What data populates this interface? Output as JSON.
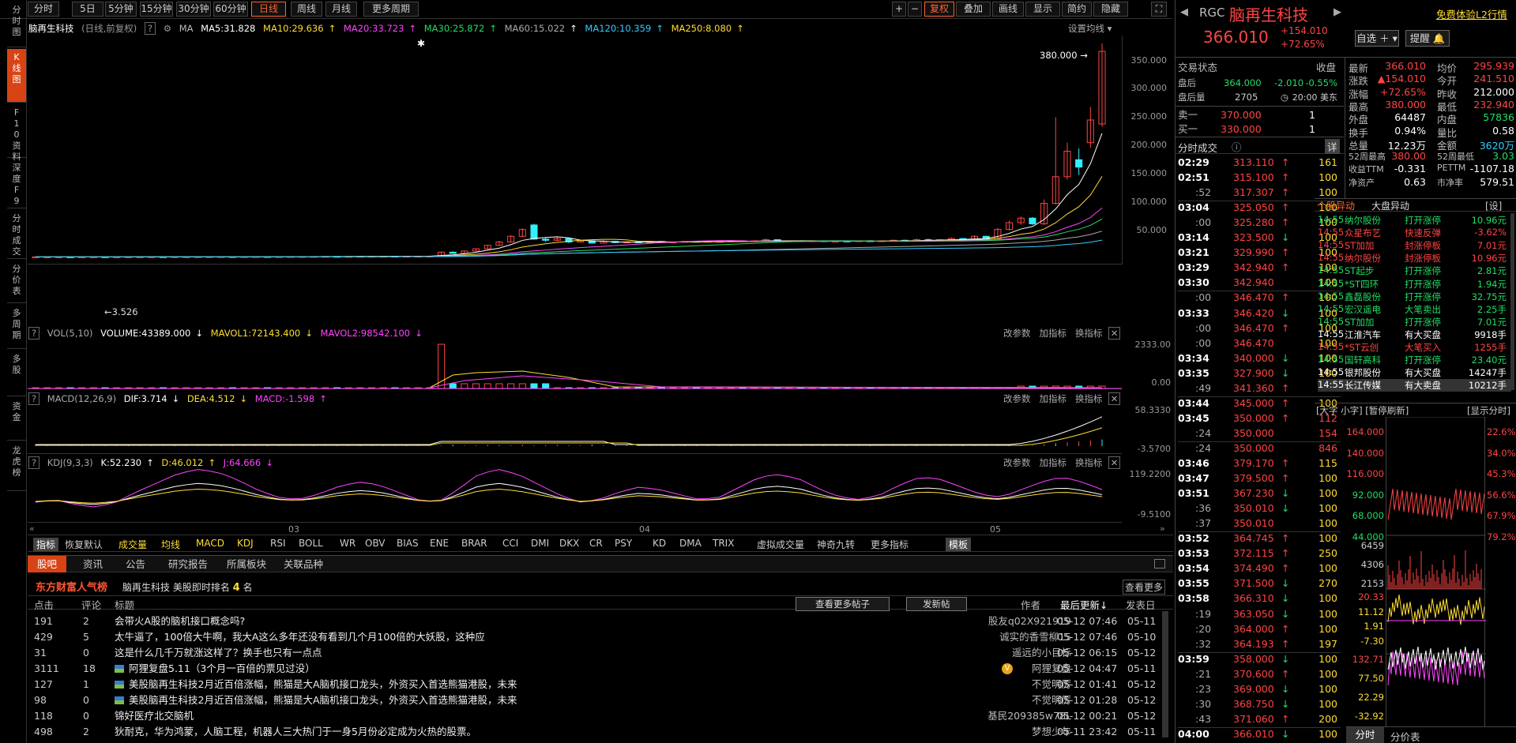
{
  "toolbar": {
    "periods": [
      "分时",
      "5日",
      "5分钟",
      "15分钟",
      "30分钟",
      "60分钟",
      "日线",
      "周线",
      "月线",
      "更多周期"
    ],
    "right": [
      "复权",
      "叠加",
      "画线",
      "显示",
      "简约",
      "隐藏"
    ]
  },
  "side_tabs": [
    "分时图",
    "K线图",
    "F10资料",
    "深度F9",
    "分时成交",
    "分价表",
    "多周期",
    "多股",
    "资金",
    "龙虎榜"
  ],
  "chart": {
    "stock_name": "脑再生科技",
    "mode": "(日线,前复权)",
    "ma_label": "MA",
    "ma": [
      "MA5:31.828",
      "MA10:29.636",
      "MA20:33.723",
      "MA30:25.872",
      "MA60:15.022",
      "MA120:10.359",
      "MA250:8.080"
    ],
    "settings": "设置均线",
    "high_label": "380.000",
    "low_label": "3.526",
    "y_ticks": [
      "350.000",
      "300.000",
      "250.000",
      "200.000",
      "150.000",
      "100.000",
      "50.000"
    ],
    "vol_head": [
      "VOL(5,10)",
      "VOLUME:43389.000",
      "MAVOL1:72143.400",
      "MAVOL2:98542.100"
    ],
    "vol_ticks": [
      "2333.00",
      "0.00"
    ],
    "macd_head": [
      "MACD(12,26,9)",
      "DIF:3.714",
      "DEA:4.512",
      "MACD:-1.598"
    ],
    "macd_ticks": [
      "58.3330",
      "-3.5700"
    ],
    "kdj_head": [
      "KDJ(9,3,3)",
      "K:52.230",
      "D:46.012",
      "J:64.666"
    ],
    "kdj_ticks": [
      "119.2200",
      "-9.5100"
    ],
    "pane_tools": [
      "改参数",
      "加指标",
      "换指标"
    ],
    "x_labels": [
      "03",
      "04",
      "05"
    ]
  },
  "chart_data": {
    "type": "candlestick",
    "title": "脑再生科技",
    "ylim": [
      0,
      380
    ],
    "x_labels": [
      "03",
      "04",
      "05"
    ],
    "candles": [
      {
        "o": 3.6,
        "c": 3.7,
        "h": 3.9,
        "l": 3.5
      },
      {
        "o": 3.6,
        "c": 3.6,
        "h": 3.8,
        "l": 3.5
      },
      {
        "o": 3.6,
        "c": 3.7,
        "h": 3.9,
        "l": 3.5
      },
      {
        "o": 3.7,
        "c": 3.6,
        "h": 3.8,
        "l": 3.5
      },
      {
        "o": 3.6,
        "c": 3.7,
        "h": 3.8,
        "l": 3.5
      },
      {
        "o": 3.7,
        "c": 3.8,
        "h": 3.9,
        "l": 3.6
      },
      {
        "o": 3.8,
        "c": 3.7,
        "h": 3.9,
        "l": 3.6
      },
      {
        "o": 3.7,
        "c": 3.7,
        "h": 3.8,
        "l": 3.6
      },
      {
        "o": 3.7,
        "c": 3.8,
        "h": 3.9,
        "l": 3.6
      },
      {
        "o": 3.8,
        "c": 3.8,
        "h": 4.0,
        "l": 3.7
      },
      {
        "o": 3.8,
        "c": 3.9,
        "h": 4.0,
        "l": 3.7
      },
      {
        "o": 3.9,
        "c": 3.8,
        "h": 4.0,
        "l": 3.7
      },
      {
        "o": 3.8,
        "c": 3.9,
        "h": 4.0,
        "l": 3.7
      },
      {
        "o": 3.9,
        "c": 3.9,
        "h": 4.0,
        "l": 3.8
      },
      {
        "o": 3.9,
        "c": 4.0,
        "h": 4.1,
        "l": 3.8
      },
      {
        "o": 4.0,
        "c": 4.0,
        "h": 4.1,
        "l": 3.9
      },
      {
        "o": 4.0,
        "c": 4.1,
        "h": 4.2,
        "l": 3.9
      },
      {
        "o": 4.1,
        "c": 4.0,
        "h": 4.2,
        "l": 3.9
      },
      {
        "o": 4.0,
        "c": 4.1,
        "h": 4.2,
        "l": 3.9
      },
      {
        "o": 4.1,
        "c": 4.2,
        "h": 4.3,
        "l": 4.0
      },
      {
        "o": 4.2,
        "c": 4.1,
        "h": 4.3,
        "l": 4.0
      },
      {
        "o": 4.1,
        "c": 4.2,
        "h": 4.3,
        "l": 4.0
      },
      {
        "o": 4.2,
        "c": 4.3,
        "h": 4.4,
        "l": 4.1
      },
      {
        "o": 4.3,
        "c": 4.3,
        "h": 4.4,
        "l": 4.2
      },
      {
        "o": 4.3,
        "c": 4.4,
        "h": 4.5,
        "l": 4.2
      },
      {
        "o": 4.4,
        "c": 4.5,
        "h": 4.6,
        "l": 4.3
      },
      {
        "o": 4.5,
        "c": 4.4,
        "h": 4.6,
        "l": 4.3
      },
      {
        "o": 4.4,
        "c": 4.5,
        "h": 4.6,
        "l": 4.3
      },
      {
        "o": 4.5,
        "c": 4.6,
        "h": 4.7,
        "l": 4.4
      },
      {
        "o": 4.6,
        "c": 4.7,
        "h": 4.8,
        "l": 4.5
      },
      {
        "o": 4.7,
        "c": 4.8,
        "h": 4.9,
        "l": 4.6
      },
      {
        "o": 4.8,
        "c": 4.7,
        "h": 4.9,
        "l": 4.6
      },
      {
        "o": 4.7,
        "c": 4.8,
        "h": 4.9,
        "l": 4.6
      },
      {
        "o": 4.8,
        "c": 4.9,
        "h": 5.0,
        "l": 4.7
      },
      {
        "o": 4.9,
        "c": 5.0,
        "h": 5.1,
        "l": 4.8
      },
      {
        "o": 5.0,
        "c": 12.0,
        "h": 13.0,
        "l": 5.0
      },
      {
        "o": 12.0,
        "c": 10.0,
        "h": 13.5,
        "l": 9.5
      },
      {
        "o": 10.0,
        "c": 14.0,
        "h": 15.0,
        "l": 9.8
      },
      {
        "o": 14.0,
        "c": 18.0,
        "h": 19.0,
        "l": 13.5
      },
      {
        "o": 18.0,
        "c": 24.0,
        "h": 25.0,
        "l": 17.0
      },
      {
        "o": 24.0,
        "c": 30.0,
        "h": 32.0,
        "l": 23.0
      },
      {
        "o": 30.0,
        "c": 40.0,
        "h": 42.0,
        "l": 29.0
      },
      {
        "o": 40.0,
        "c": 52.0,
        "h": 54.0,
        "l": 39.0
      },
      {
        "o": 60.0,
        "c": 35.0,
        "h": 62.0,
        "l": 34.0
      },
      {
        "o": 35.0,
        "c": 33.0,
        "h": 38.0,
        "l": 30.0
      },
      {
        "o": 33.0,
        "c": 36.0,
        "h": 39.0,
        "l": 31.0
      },
      {
        "o": 36.0,
        "c": 30.0,
        "h": 37.0,
        "l": 28.0
      },
      {
        "o": 30.0,
        "c": 32.0,
        "h": 34.0,
        "l": 29.0
      },
      {
        "o": 32.0,
        "c": 28.0,
        "h": 33.0,
        "l": 27.0
      },
      {
        "o": 28.0,
        "c": 31.0,
        "h": 33.0,
        "l": 27.0
      },
      {
        "o": 31.0,
        "c": 29.0,
        "h": 32.0,
        "l": 28.0
      },
      {
        "o": 29.0,
        "c": 30.0,
        "h": 31.0,
        "l": 28.0
      },
      {
        "o": 30.0,
        "c": 29.0,
        "h": 31.0,
        "l": 28.0
      },
      {
        "o": 29.0,
        "c": 31.0,
        "h": 32.0,
        "l": 28.0
      },
      {
        "o": 31.0,
        "c": 30.0,
        "h": 32.0,
        "l": 29.0
      },
      {
        "o": 30.0,
        "c": 30.0,
        "h": 31.0,
        "l": 29.0
      },
      {
        "o": 30.0,
        "c": 31.0,
        "h": 32.0,
        "l": 29.0
      },
      {
        "o": 31.0,
        "c": 30.0,
        "h": 32.0,
        "l": 29.0
      },
      {
        "o": 30.0,
        "c": 31.0,
        "h": 32.0,
        "l": 29.0
      },
      {
        "o": 31.0,
        "c": 31.0,
        "h": 32.0,
        "l": 30.0
      },
      {
        "o": 31.0,
        "c": 32.0,
        "h": 33.0,
        "l": 30.0
      },
      {
        "o": 32.0,
        "c": 31.0,
        "h": 33.0,
        "l": 30.0
      },
      {
        "o": 31.0,
        "c": 32.0,
        "h": 33.0,
        "l": 30.0
      },
      {
        "o": 32.0,
        "c": 34.0,
        "h": 36.0,
        "l": 31.0
      },
      {
        "o": 34.0,
        "c": 31.0,
        "h": 35.0,
        "l": 30.0
      },
      {
        "o": 31.0,
        "c": 32.0,
        "h": 33.0,
        "l": 30.0
      },
      {
        "o": 32.0,
        "c": 31.0,
        "h": 33.0,
        "l": 30.0
      },
      {
        "o": 31.0,
        "c": 32.0,
        "h": 33.0,
        "l": 30.0
      },
      {
        "o": 32.0,
        "c": 31.0,
        "h": 33.0,
        "l": 30.0
      },
      {
        "o": 31.0,
        "c": 31.5,
        "h": 32.5,
        "l": 30.5
      },
      {
        "o": 31.5,
        "c": 31.0,
        "h": 32.5,
        "l": 30.5
      },
      {
        "o": 31.0,
        "c": 32.0,
        "h": 33.0,
        "l": 30.0
      },
      {
        "o": 32.0,
        "c": 31.0,
        "h": 33.0,
        "l": 30.0
      },
      {
        "o": 31.0,
        "c": 32.0,
        "h": 33.0,
        "l": 30.0
      },
      {
        "o": 32.0,
        "c": 33.0,
        "h": 34.0,
        "l": 31.0
      },
      {
        "o": 33.0,
        "c": 32.0,
        "h": 34.0,
        "l": 31.0
      },
      {
        "o": 32.0,
        "c": 34.0,
        "h": 36.0,
        "l": 31.0
      },
      {
        "o": 34.0,
        "c": 33.0,
        "h": 36.0,
        "l": 32.0
      },
      {
        "o": 33.0,
        "c": 34.0,
        "h": 35.0,
        "l": 32.0
      },
      {
        "o": 34.0,
        "c": 36.0,
        "h": 38.0,
        "l": 33.0
      },
      {
        "o": 36.0,
        "c": 34.0,
        "h": 37.0,
        "l": 33.0
      },
      {
        "o": 34.0,
        "c": 40.0,
        "h": 42.0,
        "l": 33.0
      },
      {
        "o": 40.0,
        "c": 36.0,
        "h": 41.0,
        "l": 35.0
      },
      {
        "o": 36.0,
        "c": 52.0,
        "h": 55.0,
        "l": 35.0
      },
      {
        "o": 52.0,
        "c": 64.0,
        "h": 68.0,
        "l": 50.0
      },
      {
        "o": 64.0,
        "c": 72.0,
        "h": 75.0,
        "l": 60.0
      },
      {
        "o": 72.0,
        "c": 62.0,
        "h": 74.0,
        "l": 60.0
      },
      {
        "o": 62.0,
        "c": 98.0,
        "h": 105.0,
        "l": 60.0
      },
      {
        "o": 98.0,
        "c": 145.0,
        "h": 250.0,
        "l": 96.0
      },
      {
        "o": 145.0,
        "c": 190.0,
        "h": 205.0,
        "l": 140.0
      },
      {
        "o": 175.0,
        "c": 162.0,
        "h": 195.0,
        "l": 148.0
      },
      {
        "o": 205.0,
        "c": 245.0,
        "h": 268.0,
        "l": 196.0
      },
      {
        "o": 238.0,
        "c": 366.01,
        "h": 380.0,
        "l": 232.94
      }
    ]
  },
  "bottom_tabs": [
    "指标",
    "恢复默认",
    "成交量",
    "均线",
    "MACD",
    "KDJ",
    "RSI",
    "BOLL",
    "WR",
    "OBV",
    "BIAS",
    "ENE",
    "BRAR",
    "CCI",
    "DMI",
    "DKX",
    "CR",
    "PSY",
    "KD",
    "DMA",
    "TRIX",
    "虚拟成交量",
    "神奇九转",
    "更多指标",
    "模板"
  ],
  "news": {
    "tabs": [
      "股吧",
      "资讯",
      "公告",
      "研究报告",
      "所属板块",
      "关联品种"
    ],
    "brand": "东方财富人气榜",
    "rank_text": "脑再生科技 美股即时排名",
    "rank_num": "4",
    "rank_unit": "名",
    "more": "查看更多",
    "cols": [
      "点击",
      "评论",
      "标题",
      "作者",
      "最后更新",
      "发表日"
    ],
    "view_more_btn": "查看更多帖子",
    "post_btn": "发新帖",
    "rows": [
      {
        "click": "191",
        "comments": "2",
        "title": "会带火A股的脑机接口概念吗?",
        "author": "股友q02X921919",
        "updated": "05-12 07:46",
        "date": "05-11",
        "img": false
      },
      {
        "click": "429",
        "comments": "5",
        "title": "太牛逼了，100倍大牛啊，我大A这么多年还没有看到几个月100倍的大妖股，这种应",
        "author": "诚实的香雪柳15",
        "updated": "05-12 07:46",
        "date": "05-10",
        "img": false
      },
      {
        "click": "31",
        "comments": "0",
        "title": "这是什么几千万就涨这样了？换手也只有一点点",
        "author": "遥远的小目标",
        "updated": "05-12 06:15",
        "date": "05-12",
        "img": false
      },
      {
        "click": "3111",
        "comments": "18",
        "title": "阿狸复盘5.11（3个月一百倍的票见过没）",
        "author": "阿狸复盘",
        "updated": "05-12 04:47",
        "date": "05-11",
        "img": true
      },
      {
        "click": "127",
        "comments": "1",
        "title": "美股脑再生科技2月近百倍涨幅，熊猫是大A脑机接口龙头，外资买入首选熊猫港股，未来",
        "author": "不觉明厉",
        "updated": "05-12 01:41",
        "date": "05-12",
        "img": true
      },
      {
        "click": "98",
        "comments": "0",
        "title": "美股脑再生科技2月近百倍涨幅，熊猫是大A脑机接口龙头，外资买入首选熊猫港股，未来",
        "author": "不觉明厉",
        "updated": "05-12 01:28",
        "date": "05-12",
        "img": true
      },
      {
        "click": "118",
        "comments": "0",
        "title": "锦好医疗北交脑机",
        "author": "基民209385w78L",
        "updated": "05-12 00:21",
        "date": "05-12",
        "img": false
      },
      {
        "click": "498",
        "comments": "2",
        "title": "狄耐克，华为鸿蒙，人脑工程，机器人三大热门于一身5月份必定成为火热的股票。",
        "author": "梦想少年",
        "updated": "05-11 23:42",
        "date": "05-11",
        "img": false
      }
    ]
  },
  "quote": {
    "code": "RGC",
    "name": "脑再生科技",
    "promo": "免费体验L2行情",
    "price": "366.010",
    "change": "+154.010",
    "change_pct": "+72.65%",
    "watch_btn": "自选",
    "alert_btn": "提醒",
    "trade_status_label": "交易状态",
    "trade_status": "收盘",
    "after_label": "盘后",
    "after_price": "364.000",
    "after_chg": "-2.010",
    "after_pct": "-0.55%",
    "after_vol_label": "盘后量",
    "after_vol": "2705",
    "after_time": "20:00 美东",
    "ask_label": "卖一",
    "ask_price": "370.000",
    "ask_vol": "1",
    "bid_label": "买一",
    "bid_price": "330.000",
    "bid_vol": "1",
    "trades_title": "分时成交",
    "trades_detail": "详",
    "stats": [
      [
        "最新",
        "366.010",
        "均价",
        "295.939"
      ],
      [
        "涨跌",
        "▲154.010",
        "今开",
        "241.510"
      ],
      [
        "涨幅",
        "+72.65%",
        "昨收",
        "212.000"
      ],
      [
        "最高",
        "380.000",
        "最低",
        "232.940"
      ],
      [
        "外盘",
        "64487",
        "内盘",
        "57836"
      ],
      [
        "换手",
        "0.94%",
        "量比",
        "0.58"
      ],
      [
        "总量",
        "12.23万",
        "金额",
        "3620万"
      ],
      [
        "52周最高",
        "380.00",
        "52周最低",
        "3.03"
      ],
      [
        "收益TTM",
        "-0.331",
        "PETTM",
        "-1107.18"
      ],
      [
        "净资产",
        "0.63",
        "市净率",
        "579.51"
      ]
    ]
  },
  "trades": [
    [
      "02:29",
      "313.110",
      "up",
      "161"
    ],
    [
      "02:51",
      "315.100",
      "up",
      "100"
    ],
    [
      ":52",
      "317.307",
      "up",
      "100"
    ],
    [
      "03:04",
      "325.050",
      "up",
      "100"
    ],
    [
      ":00",
      "325.280",
      "up",
      "100"
    ],
    [
      "03:14",
      "323.500",
      "dn",
      "100"
    ],
    [
      "03:21",
      "329.990",
      "up",
      "100"
    ],
    [
      "03:29",
      "342.940",
      "up",
      "100"
    ],
    [
      "03:30",
      "342.940",
      "",
      "100"
    ],
    [
      ":00",
      "346.470",
      "up",
      "100"
    ],
    [
      "03:33",
      "346.420",
      "dn",
      "100"
    ],
    [
      ":00",
      "346.470",
      "up",
      "100"
    ],
    [
      ":00",
      "346.470",
      "",
      "100"
    ],
    [
      "03:34",
      "340.000",
      "dn",
      "100"
    ],
    [
      "03:35",
      "327.900",
      "dn",
      "100"
    ],
    [
      ":49",
      "341.360",
      "up",
      "100"
    ],
    [
      "03:44",
      "345.000",
      "up",
      "100"
    ],
    [
      "03:45",
      "350.000",
      "up",
      "112"
    ],
    [
      ":24",
      "350.000",
      "",
      "154"
    ],
    [
      ":24",
      "350.000",
      "",
      "846"
    ],
    [
      "03:46",
      "379.170",
      "up",
      "115"
    ],
    [
      "03:47",
      "379.500",
      "up",
      "100"
    ],
    [
      "03:51",
      "367.230",
      "dn",
      "100"
    ],
    [
      ":36",
      "350.010",
      "dn",
      "100"
    ],
    [
      ":37",
      "350.010",
      "",
      "100"
    ],
    [
      "03:52",
      "364.745",
      "up",
      "100"
    ],
    [
      "03:53",
      "372.115",
      "up",
      "250"
    ],
    [
      "03:54",
      "374.490",
      "up",
      "100"
    ],
    [
      "03:55",
      "371.500",
      "dn",
      "270"
    ],
    [
      "03:58",
      "366.310",
      "dn",
      "100"
    ],
    [
      ":19",
      "363.050",
      "dn",
      "100"
    ],
    [
      ":20",
      "364.000",
      "up",
      "100"
    ],
    [
      ":32",
      "364.193",
      "up",
      "197"
    ],
    [
      "03:59",
      "358.000",
      "dn",
      "100"
    ],
    [
      ":21",
      "370.600",
      "up",
      "100"
    ],
    [
      ":23",
      "369.000",
      "dn",
      "100"
    ],
    [
      ":30",
      "368.750",
      "dn",
      "100"
    ],
    [
      ":43",
      "371.060",
      "up",
      "200"
    ],
    [
      "04:00",
      "366.010",
      "dn",
      "100"
    ]
  ],
  "anomaly": {
    "tabs": [
      "个股异动",
      "大盘异动",
      "[设]"
    ],
    "rows": [
      [
        "14:55",
        "纳尔股份",
        "打开涨停",
        "10.96元",
        "dn"
      ],
      [
        "14:55",
        "众星布艺",
        "快速反弹",
        "-3.62%",
        "up"
      ],
      [
        "14:55",
        "ST加加",
        "封涨停板",
        "7.01元",
        "up"
      ],
      [
        "14:55",
        "纳尔股份",
        "封涨停板",
        "10.96元",
        "up"
      ],
      [
        "14:55",
        "ST起步",
        "打开涨停",
        "2.81元",
        "dn"
      ],
      [
        "14:55",
        "*ST四环",
        "打开涨停",
        "1.94元",
        "dn"
      ],
      [
        "14:55",
        "鑫磊股份",
        "打开涨停",
        "32.75元",
        "dn"
      ],
      [
        "14:55",
        "宏汉遥电",
        "大笔卖出",
        "2.25手",
        "dn"
      ],
      [
        "14:55",
        "ST加加",
        "打开涨停",
        "7.01元",
        "dn"
      ],
      [
        "14:55",
        "江淮汽车",
        "有大买盘",
        "9918手",
        "wh"
      ],
      [
        "14:55",
        "*ST云创",
        "大笔买入",
        "1255手",
        "up"
      ],
      [
        "14:55",
        "国轩高科",
        "打开涨停",
        "23.40元",
        "dn"
      ],
      [
        "14:55",
        "银邦股份",
        "有大买盘",
        "14247手",
        "wh"
      ],
      [
        "14:55",
        "长江传媒",
        "有大卖盘",
        "10212手",
        "wh"
      ]
    ]
  },
  "mini": {
    "controls": "[大字 小字] [暂停刷新]",
    "show_btn": "[显示分时]",
    "prices": [
      "164.000",
      "140.000",
      "116.000",
      "92.000",
      "68.000",
      "44.000"
    ],
    "pcts": [
      "22.6%",
      "34.0%",
      "45.3%",
      "56.6%",
      "67.9%",
      "79.2%"
    ],
    "vol": [
      "6459",
      "4306",
      "2153"
    ],
    "macd": [
      "20.33",
      "11.12",
      "1.91",
      "-7.30"
    ],
    "kdj": [
      "132.71",
      "77.50",
      "22.29",
      "-32.92"
    ],
    "tabs": [
      "分时",
      "分价表"
    ]
  }
}
